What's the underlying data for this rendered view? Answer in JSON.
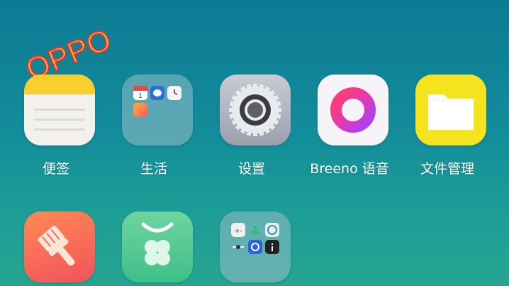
{
  "watermark": "OPPO",
  "apps": {
    "notes": "便签",
    "life_folder": "生活",
    "settings": "设置",
    "breeno": "Breeno 语音",
    "files": "文件管理"
  },
  "colors": {
    "notes_header": "#f7cf2e",
    "files_bg": "#f3e41f",
    "breeno_ring_start": "#ff4a7a",
    "breeno_ring_end": "#a640ff",
    "cleaner_bg": "#f0525a",
    "green_app_bg": "#3fbf88"
  }
}
